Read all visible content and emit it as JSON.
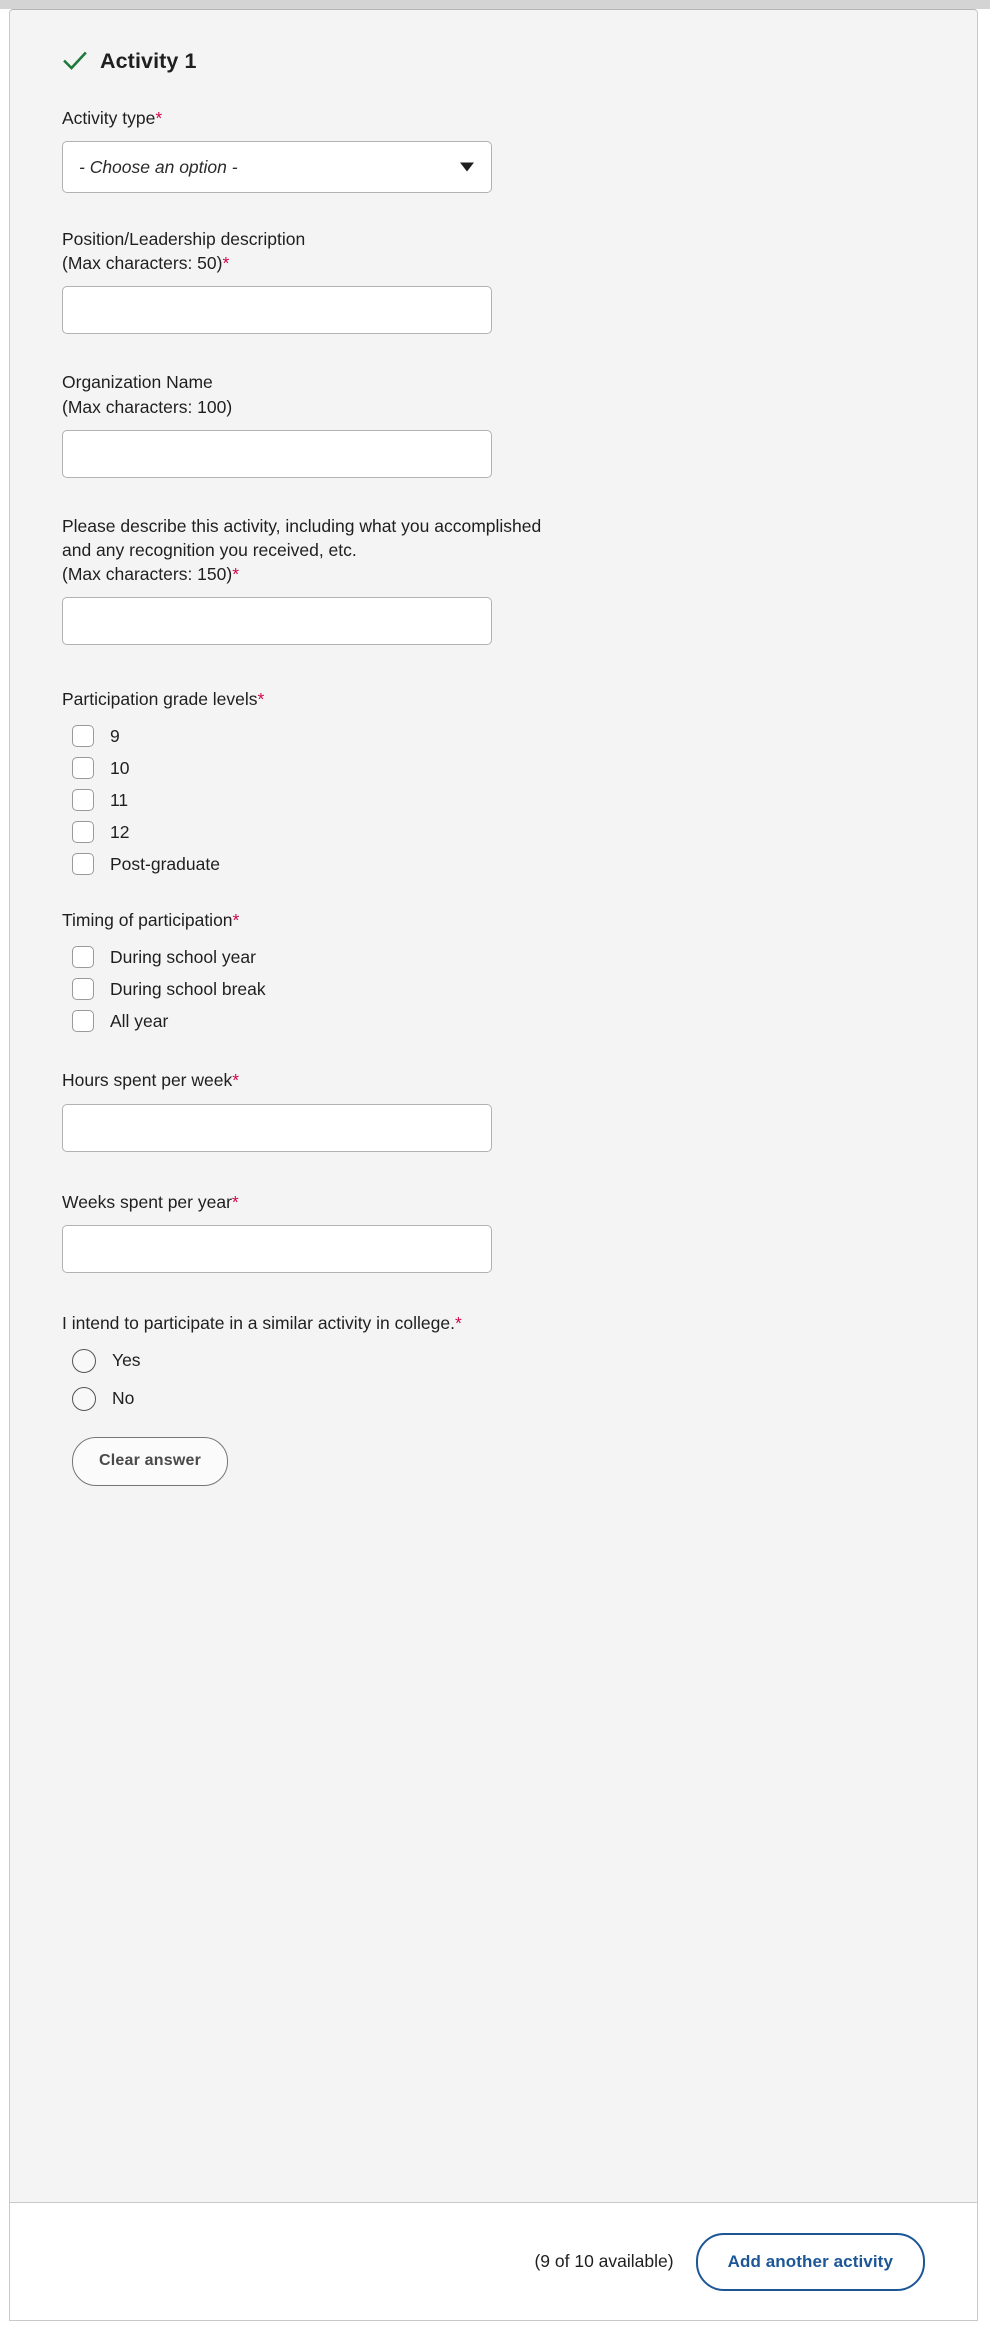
{
  "activity": {
    "status_icon": "green-check-icon",
    "status_color": "#1e7a3c",
    "title": "Activity 1"
  },
  "fields": {
    "activity_type": {
      "label": "Activity type",
      "required": true,
      "required_mark": "*",
      "selected_option": "- Choose an option -",
      "caret_icon": "chevron-down-icon"
    },
    "position": {
      "label_line1": "Position/Leadership description",
      "label_line2": "(Max characters: 50)",
      "required_mark": "*",
      "value": ""
    },
    "organization": {
      "label_line1": "Organization Name",
      "label_line2": "(Max characters: 100)",
      "required_mark": "",
      "value": ""
    },
    "description": {
      "label_line1": "Please describe this activity, including what you accomplished",
      "label_line2": "and any recognition you received, etc.",
      "label_line3": "(Max characters: 150)",
      "required_mark": "*",
      "value": ""
    },
    "hours_per_week": {
      "label": "Hours spent per week",
      "required_mark": "*",
      "value": ""
    },
    "weeks_per_year": {
      "label": "Weeks spent per year",
      "required_mark": "*",
      "value": ""
    }
  },
  "grade_levels": {
    "label": "Participation grade levels",
    "required_mark": "*",
    "options": [
      {
        "label": "9",
        "checked": false
      },
      {
        "label": "10",
        "checked": false
      },
      {
        "label": "11",
        "checked": false
      },
      {
        "label": "12",
        "checked": false
      },
      {
        "label": "Post-graduate",
        "checked": false
      }
    ]
  },
  "timing": {
    "label": "Timing of participation",
    "required_mark": "*",
    "options": [
      {
        "label": "During school year",
        "checked": false
      },
      {
        "label": "During school break",
        "checked": false
      },
      {
        "label": "All year",
        "checked": false
      }
    ]
  },
  "intent": {
    "label": "I intend to participate in a similar activity in college.",
    "required_mark": "*",
    "options": [
      {
        "label": "Yes",
        "selected": false
      },
      {
        "label": "No",
        "selected": false
      }
    ],
    "clear_label": "Clear answer"
  },
  "footer": {
    "availability_text": "(9 of 10 available)",
    "add_button_label": "Add another activity",
    "accent_color": "#1c5697"
  }
}
